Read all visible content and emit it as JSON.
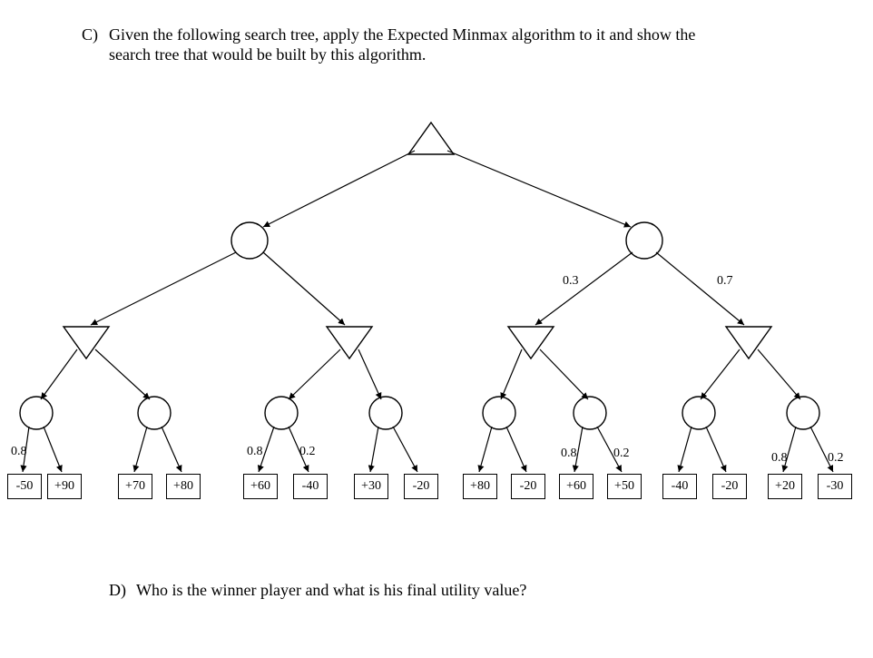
{
  "question_c": {
    "letter": "C)",
    "text_line1": "Given the following search tree, apply the Expected Minmax algorithm to it and show the",
    "text_line2": "search tree that would be built by this algorithm."
  },
  "question_d": {
    "letter": "D)",
    "text": "Who is the winner player and what is his final utility value?"
  },
  "probabilities": {
    "L2_right_left": "0.3",
    "L2_right_right": "0.7",
    "chance1_left": "0.8",
    "chance3_left": "0.8",
    "chance3_right": "0.2",
    "chance6_left": "0.8",
    "chance6_right": "0.2",
    "chance8_left": "0.8",
    "chance8_right": "0.2"
  },
  "leaves": {
    "v1": "-50",
    "v2": "+90",
    "v3": "+70",
    "v4": "+80",
    "v5": "+60",
    "v6": "-40",
    "v7": "+30",
    "v8": "-20",
    "v9": "+80",
    "v10": "-20",
    "v11": "+60",
    "v12": "+50",
    "v13": "-40",
    "v14": "-20",
    "v15": "+20",
    "v16": "-30"
  },
  "chart_data": {
    "type": "tree-diagram",
    "description": "Expectiminimax search tree",
    "nodes": {
      "root": {
        "type": "max",
        "children": [
          "min_L",
          "min_R"
        ]
      },
      "min_L": {
        "type": "min",
        "children": [
          "maxA",
          "maxB"
        ]
      },
      "min_R": {
        "type": "min",
        "children": [
          "maxC",
          "maxD"
        ],
        "edge_probs": [
          0.3,
          0.7
        ]
      },
      "maxA": {
        "type": "max",
        "children": [
          "c1",
          "c2"
        ]
      },
      "maxB": {
        "type": "max",
        "children": [
          "c3",
          "c4"
        ]
      },
      "maxC": {
        "type": "max",
        "children": [
          "c5",
          "c6"
        ]
      },
      "maxD": {
        "type": "max",
        "children": [
          "c7",
          "c8"
        ]
      },
      "c1": {
        "type": "chance",
        "children": [
          -50,
          90
        ],
        "probs": [
          0.8,
          null
        ]
      },
      "c2": {
        "type": "chance",
        "children": [
          70,
          80
        ]
      },
      "c3": {
        "type": "chance",
        "children": [
          60,
          -40
        ],
        "probs": [
          0.8,
          0.2
        ]
      },
      "c4": {
        "type": "chance",
        "children": [
          30,
          -20
        ]
      },
      "c5": {
        "type": "chance",
        "children": [
          80,
          -20
        ]
      },
      "c6": {
        "type": "chance",
        "children": [
          60,
          50
        ],
        "probs": [
          0.8,
          0.2
        ]
      },
      "c7": {
        "type": "chance",
        "children": [
          -40,
          -20
        ]
      },
      "c8": {
        "type": "chance",
        "children": [
          20,
          -30
        ],
        "probs": [
          0.8,
          0.2
        ]
      }
    }
  }
}
